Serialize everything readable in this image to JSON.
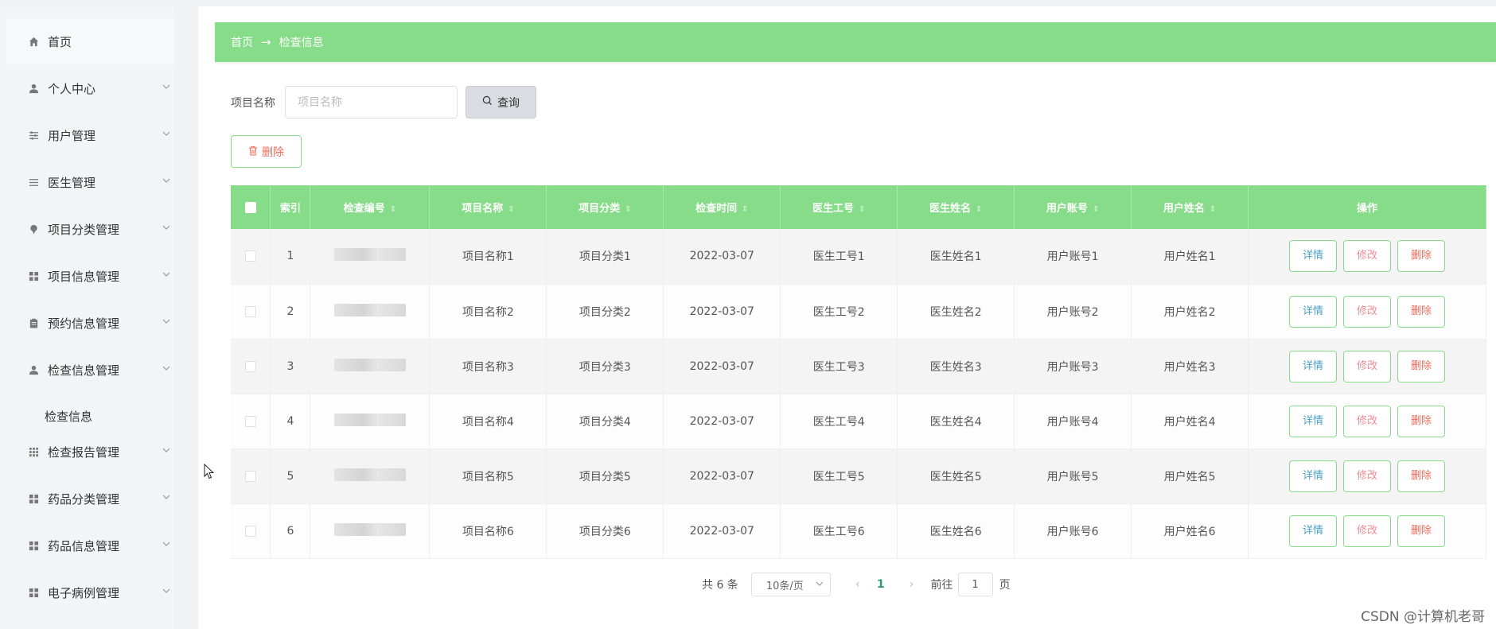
{
  "sidebar": {
    "items": [
      {
        "label": "首页",
        "icon": "home-icon"
      },
      {
        "label": "个人中心",
        "icon": "user-icon"
      },
      {
        "label": "用户管理",
        "icon": "sliders-icon"
      },
      {
        "label": "医生管理",
        "icon": "list-icon"
      },
      {
        "label": "项目分类管理",
        "icon": "pin-icon"
      },
      {
        "label": "项目信息管理",
        "icon": "grid-icon"
      },
      {
        "label": "预约信息管理",
        "icon": "clipboard-icon"
      },
      {
        "label": "检查信息管理",
        "icon": "user-icon"
      },
      {
        "label": "检查报告管理",
        "icon": "apps-icon"
      },
      {
        "label": "药品分类管理",
        "icon": "grid-icon"
      },
      {
        "label": "药品信息管理",
        "icon": "grid-icon"
      },
      {
        "label": "电子病例管理",
        "icon": "grid-icon"
      }
    ],
    "submenu_label": "检查信息"
  },
  "breadcrumb": {
    "home": "首页",
    "current": "检查信息"
  },
  "search": {
    "label": "项目名称",
    "placeholder": "项目名称",
    "button": "查询"
  },
  "actions": {
    "batch_delete": "删除"
  },
  "table": {
    "headers": [
      "索引",
      "检查编号",
      "项目名称",
      "项目分类",
      "检查时间",
      "医生工号",
      "医生姓名",
      "用户账号",
      "用户姓名",
      "操作"
    ],
    "rows": [
      {
        "index": "1",
        "name": "项目名称1",
        "category": "项目分类1",
        "time": "2022-03-07",
        "doctor_no": "医生工号1",
        "doctor_name": "医生姓名1",
        "account": "用户账号1",
        "user_name": "用户姓名1"
      },
      {
        "index": "2",
        "name": "项目名称2",
        "category": "项目分类2",
        "time": "2022-03-07",
        "doctor_no": "医生工号2",
        "doctor_name": "医生姓名2",
        "account": "用户账号2",
        "user_name": "用户姓名2"
      },
      {
        "index": "3",
        "name": "项目名称3",
        "category": "项目分类3",
        "time": "2022-03-07",
        "doctor_no": "医生工号3",
        "doctor_name": "医生姓名3",
        "account": "用户账号3",
        "user_name": "用户姓名3"
      },
      {
        "index": "4",
        "name": "项目名称4",
        "category": "项目分类4",
        "time": "2022-03-07",
        "doctor_no": "医生工号4",
        "doctor_name": "医生姓名4",
        "account": "用户账号4",
        "user_name": "用户姓名4"
      },
      {
        "index": "5",
        "name": "项目名称5",
        "category": "项目分类5",
        "time": "2022-03-07",
        "doctor_no": "医生工号5",
        "doctor_name": "医生姓名5",
        "account": "用户账号5",
        "user_name": "用户姓名5"
      },
      {
        "index": "6",
        "name": "项目名称6",
        "category": "项目分类6",
        "time": "2022-03-07",
        "doctor_no": "医生工号6",
        "doctor_name": "医生姓名6",
        "account": "用户账号6",
        "user_name": "用户姓名6"
      }
    ],
    "op_labels": {
      "detail": "详情",
      "edit": "修改",
      "delete": "删除"
    }
  },
  "pagination": {
    "total": "共 6 条",
    "page_size": "10条/页",
    "current_page": "1",
    "goto_prefix": "前往",
    "goto_value": "1",
    "goto_suffix": "页"
  },
  "watermark": "CSDN @计算机老哥",
  "colors": {
    "accent": "#86dc89",
    "danger": "#f26b5a",
    "info": "#4a9ec7",
    "edit": "#f08b95"
  }
}
